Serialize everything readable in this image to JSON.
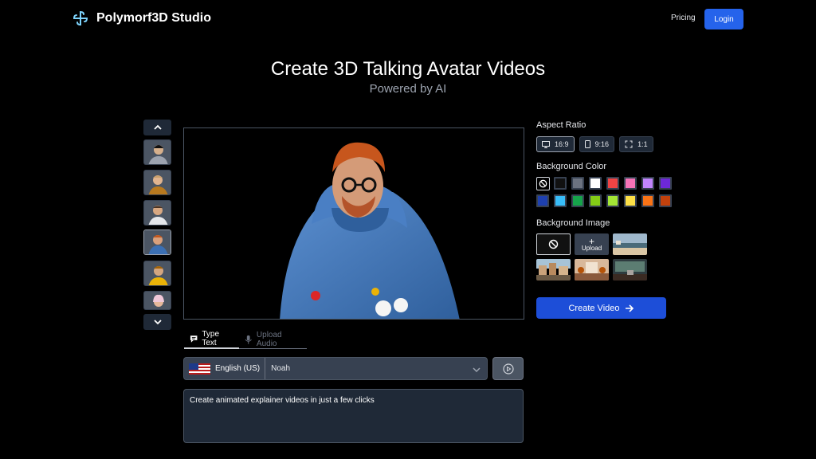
{
  "nav": {
    "brand": "Polymorf3D Studio",
    "pricing": "Pricing",
    "login": "Login"
  },
  "hero": {
    "title": "Create 3D Talking Avatar Videos",
    "subtitle": "Powered by AI"
  },
  "avatars": [
    {
      "name": "avatar-1"
    },
    {
      "name": "avatar-2"
    },
    {
      "name": "avatar-3"
    },
    {
      "name": "avatar-4",
      "selected": true
    },
    {
      "name": "avatar-5"
    },
    {
      "name": "avatar-6"
    }
  ],
  "input_tabs": {
    "type_text": "Type Text",
    "upload_audio": "Upload Audio",
    "active": "type_text"
  },
  "voice": {
    "language": "English (US)",
    "name": "Noah"
  },
  "script_text": "Create animated explainer videos in just a few clicks",
  "aspect_ratio": {
    "label": "Aspect Ratio",
    "options": [
      "16:9",
      "9:16",
      "1:1"
    ],
    "selected": "16:9"
  },
  "background_color": {
    "label": "Background Color",
    "colors": [
      "#111111",
      "#6b7280",
      "#ffffff",
      "#ef4444",
      "#f472b6",
      "#c084fc",
      "#6d28d9",
      "#1e40af",
      "#38bdf8",
      "#16a34a",
      "#84cc16",
      "#a3e635",
      "#fde047",
      "#f97316",
      "#c2410c"
    ]
  },
  "background_image": {
    "label": "Background Image",
    "upload": "Upload"
  },
  "create_button": "Create Video",
  "colors": {
    "accent": "#2563eb",
    "panel": "#1f2937"
  }
}
